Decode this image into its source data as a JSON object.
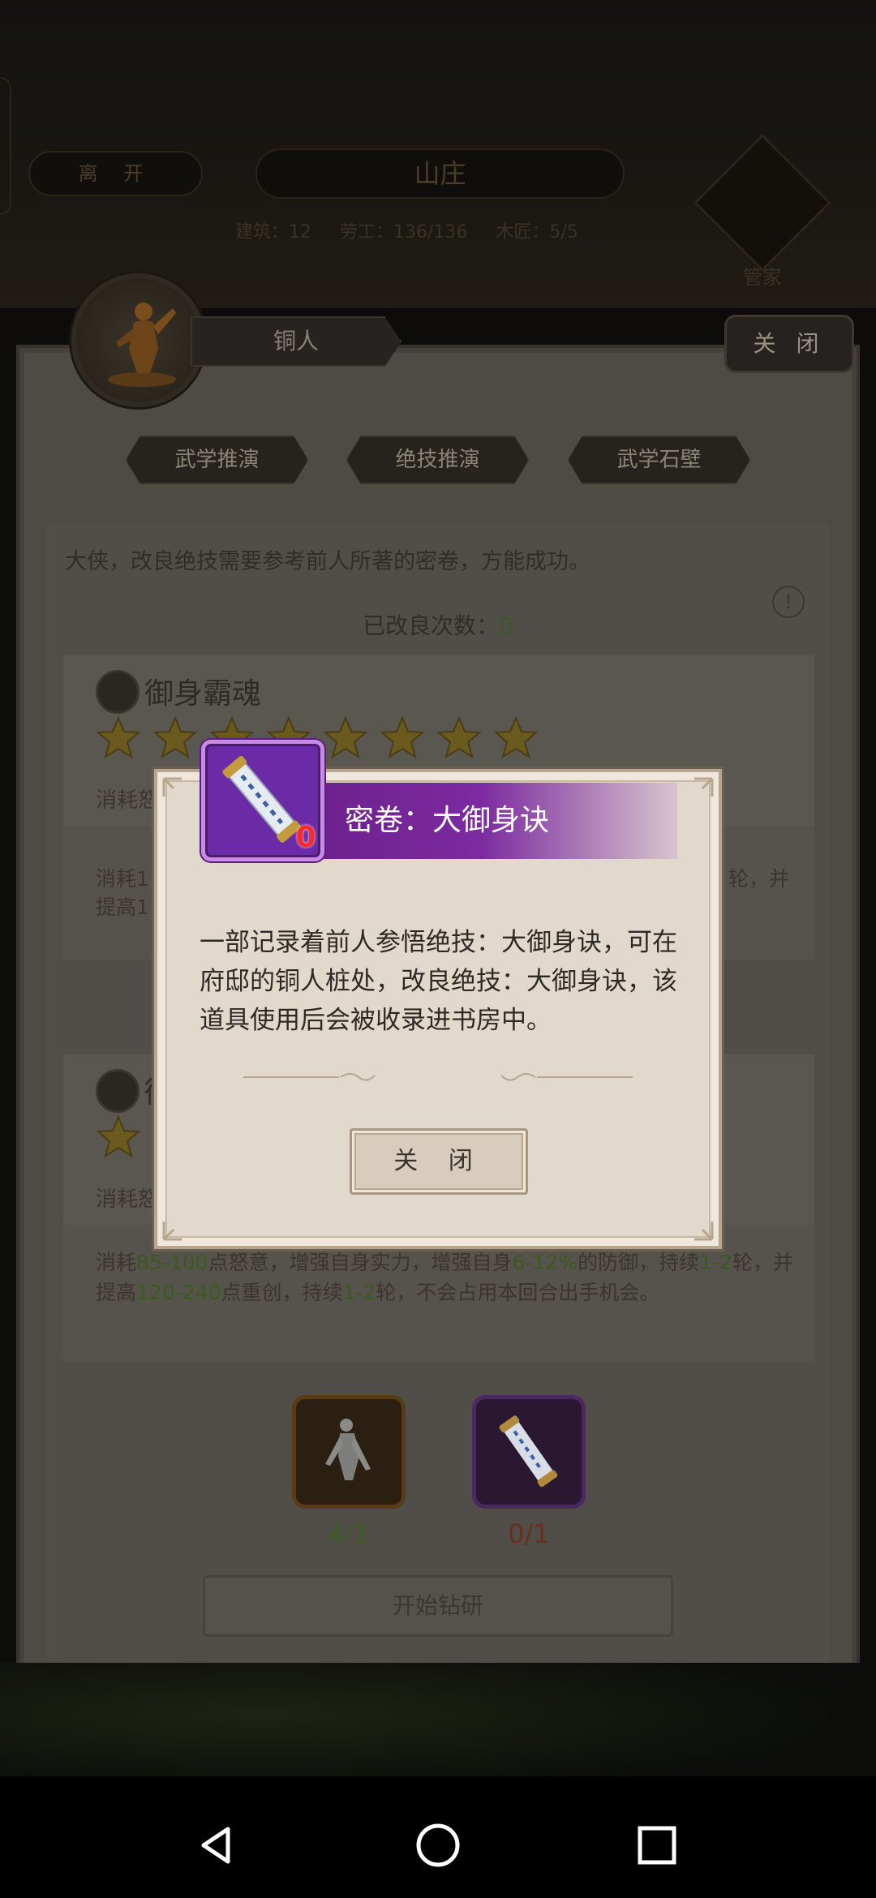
{
  "top_bar": {
    "leave_label": "离 开",
    "villa_title": "山庄",
    "stats": [
      "建筑：12",
      "劳工：136/136",
      "木匠：5/5"
    ],
    "manager_label": "管家"
  },
  "panel": {
    "title": "铜人",
    "close_label": "关 闭",
    "tabs": [
      "武学推演",
      "绝技推演",
      "武学石壁"
    ],
    "intro": "大侠，改良绝技需要参考前人所著的密卷，方能成功。",
    "count_label": "已改良次数：",
    "count_value": "0",
    "info_icon": "!"
  },
  "skills": [
    {
      "name": "御身霸魂",
      "stars": 8,
      "consume_label": "消耗怒",
      "desc_left": "消耗1",
      "desc_left2": "提高1",
      "desc_right": "轮，并"
    },
    {
      "name": "御",
      "stars": 1,
      "consume_label": "消耗怒",
      "desc": [
        {
          "t": "消耗",
          "g": false
        },
        {
          "t": "85-100",
          "g": true
        },
        {
          "t": "点怒意，增强自身实力，增强自身",
          "g": false
        },
        {
          "t": "6-12%",
          "g": true
        },
        {
          "t": "的防御，持续",
          "g": false
        },
        {
          "t": "1-2",
          "g": true
        },
        {
          "t": "轮，并提高",
          "g": false
        },
        {
          "t": "120-240",
          "g": true
        },
        {
          "t": "点重创，持续",
          "g": false
        },
        {
          "t": "1-2",
          "g": true
        },
        {
          "t": "轮，不会占用本回合出手机会。",
          "g": false
        }
      ]
    }
  ],
  "materials": [
    {
      "icon": "bronze-figure-icon",
      "count": "4/1"
    },
    {
      "icon": "scroll-icon",
      "count": "0/1"
    }
  ],
  "start_label": "开始钻研",
  "modal": {
    "title": "密卷：大御身诀",
    "item_count": "0",
    "description": "一部记录着前人参悟绝技：大御身诀，可在府邸的铜人桩处，改良绝技：大御身诀，该道具使用后会被收录进书房中。",
    "close_label": "关 闭"
  },
  "colors": {
    "header_purple": "#7c2aa0",
    "item_border": "#c98ce6",
    "count_red": "#ff2a2a",
    "highlight_green": "#3c5a20"
  }
}
